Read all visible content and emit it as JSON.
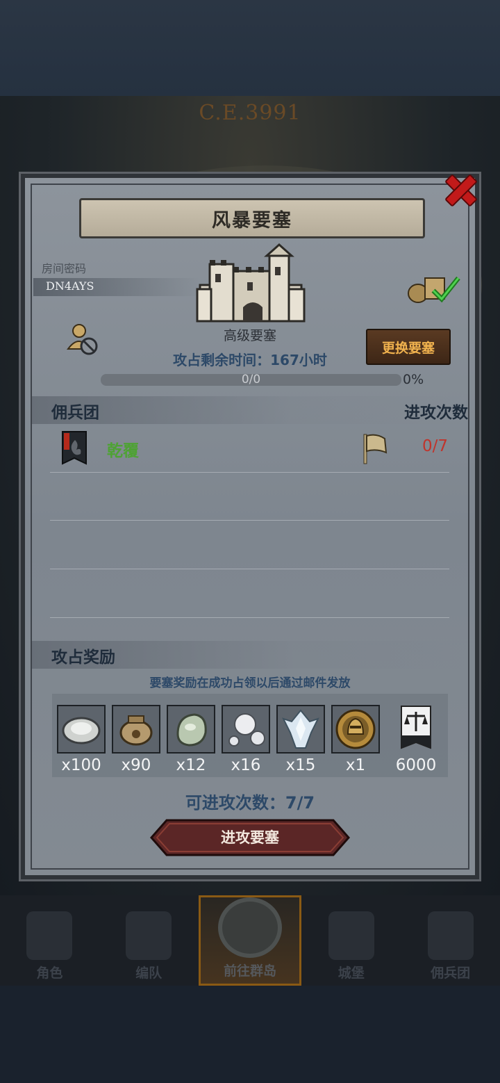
{
  "background": {
    "year": "C.E.3991"
  },
  "dialog": {
    "title": "风暴要塞",
    "room_label": "房间密码",
    "room_code": "DN4AYS",
    "fortress_level": "高级要塞",
    "swap_button": "更换要塞",
    "remaining_time": "攻占剩余时间：167小时",
    "progress": {
      "text": "0/0",
      "percent_label": "0%",
      "value": 0
    },
    "mercenary_header": "佣兵团",
    "attack_count_header": "进攻次数",
    "guild_rows": [
      {
        "name": "乾覆",
        "attacks": "0/7"
      }
    ],
    "reward_header": "攻占奖励",
    "reward_note": "要塞奖励在成功占领以后通过邮件发放",
    "rewards": [
      {
        "icon": "oyster-icon",
        "qty": "x100"
      },
      {
        "icon": "coin-sack-icon",
        "qty": "x90"
      },
      {
        "icon": "jade-stone-icon",
        "qty": "x12"
      },
      {
        "icon": "pearls-icon",
        "qty": "x16"
      },
      {
        "icon": "ice-crystal-icon",
        "qty": "x15"
      },
      {
        "icon": "knight-medal-icon",
        "qty": "x1"
      },
      {
        "icon": "justice-banner-icon",
        "qty": "6000"
      }
    ],
    "attacks_left": "可进攻次数：7/7",
    "attack_button": "进攻要塞"
  },
  "nav": [
    {
      "label": "角色",
      "active": false
    },
    {
      "label": "编队",
      "active": false
    },
    {
      "label": "前往群岛",
      "active": true
    },
    {
      "label": "城堡",
      "active": false
    },
    {
      "label": "佣兵团",
      "active": false
    }
  ],
  "colors": {
    "accent_gold": "#f0b24e",
    "guild_green": "#4ea234",
    "count_red": "#c0342c",
    "info_blue": "#2d4968"
  }
}
